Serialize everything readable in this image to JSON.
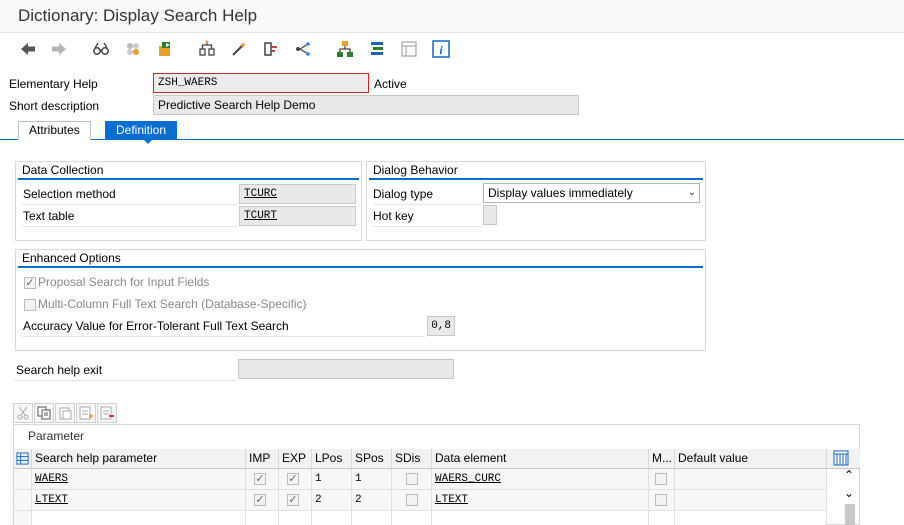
{
  "window": {
    "title": "Dictionary: Display Search Help"
  },
  "toolbar": {
    "icons": [
      "back-arrow-icon",
      "forward-arrow-icon",
      "glasses-icon",
      "other-object-icon",
      "activate-icon",
      "where-used-icon",
      "magic-wand-icon",
      "check-icon",
      "graphics-icon",
      "tree-icon",
      "object-list-icon",
      "display-object-icon",
      "info-icon"
    ]
  },
  "header": {
    "elementary_help_label": "Elementary Help",
    "elementary_help_value": "ZSH_WAERS",
    "status": "Active",
    "short_desc_label": "Short description",
    "short_desc_value": "Predictive Search Help Demo"
  },
  "tabs": [
    {
      "label": "Attributes",
      "active": false
    },
    {
      "label": "Definition",
      "active": true
    }
  ],
  "data_collection": {
    "title": "Data Collection",
    "selection_method_label": "Selection method",
    "selection_method_value": "TCURC",
    "text_table_label": "Text table",
    "text_table_value": "TCURT"
  },
  "dialog_behavior": {
    "title": "Dialog Behavior",
    "dialog_type_label": "Dialog type",
    "dialog_type_value": "Display values immediately",
    "hot_key_label": "Hot key",
    "hot_key_value": ""
  },
  "enhanced": {
    "title": "Enhanced Options",
    "proposal_label": "Proposal Search for Input Fields",
    "proposal_checked": true,
    "multicol_label": "Multi-Column Full Text Search (Database-Specific)",
    "multicol_checked": false,
    "accuracy_label": "Accuracy Value for Error-Tolerant Full Text Search",
    "accuracy_value": "0,8"
  },
  "exit": {
    "label": "Search help exit",
    "value": ""
  },
  "parameter_table": {
    "title": "Parameter",
    "columns": [
      "Search help parameter",
      "IMP",
      "EXP",
      "LPos",
      "SPos",
      "SDis",
      "Data element",
      "M...",
      "Default value"
    ],
    "rows": [
      {
        "param": "WAERS",
        "imp": true,
        "exp": true,
        "lpos": "1",
        "spos": "1",
        "sdis": false,
        "data_element": "WAERS_CURC",
        "m": false,
        "default": ""
      },
      {
        "param": "LTEXT",
        "imp": true,
        "exp": true,
        "lpos": "2",
        "spos": "2",
        "sdis": false,
        "data_element": "LTEXT",
        "m": false,
        "default": ""
      }
    ]
  },
  "colors": {
    "accent": "#0a6ed1",
    "field_bg": "#e9e9e9"
  }
}
